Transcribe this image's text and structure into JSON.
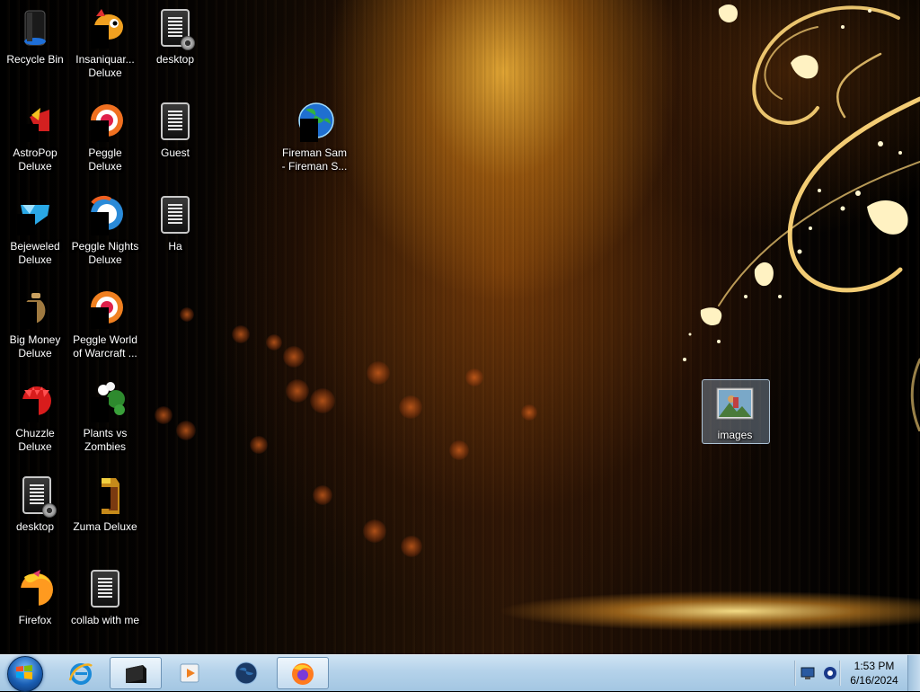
{
  "desktop": {
    "icons": [
      {
        "label": "Recycle Bin",
        "icon": "recycle-bin-icon"
      },
      {
        "label": "AstroPop Deluxe",
        "icon": "astropop-icon"
      },
      {
        "label": "Bejeweled Deluxe",
        "icon": "bejeweled-icon"
      },
      {
        "label": "Big Money Deluxe",
        "icon": "big-money-icon"
      },
      {
        "label": "Chuzzle Deluxe",
        "icon": "chuzzle-icon"
      },
      {
        "label": "desktop",
        "icon": "document-icon"
      },
      {
        "label": "Firefox",
        "icon": "firefox-icon"
      },
      {
        "label": "Insaniquar... Deluxe",
        "icon": "insaniquarium-icon"
      },
      {
        "label": "Peggle Deluxe",
        "icon": "peggle-icon"
      },
      {
        "label": "Peggle Nights Deluxe",
        "icon": "peggle-nights-icon"
      },
      {
        "label": "Peggle World of Warcraft ...",
        "icon": "peggle-wow-icon"
      },
      {
        "label": "Plants vs Zombies",
        "icon": "plants-vs-zombies-icon"
      },
      {
        "label": "Zuma Deluxe",
        "icon": "zuma-icon"
      },
      {
        "label": "collab with me",
        "icon": "document-icon"
      },
      {
        "label": "desktop",
        "icon": "document-icon"
      },
      {
        "label": "Guest",
        "icon": "document-icon"
      },
      {
        "label": "Ha",
        "icon": "document-icon"
      },
      {
        "label": "Fireman Sam - Fireman S...",
        "icon": "globe-icon"
      },
      {
        "label": "images",
        "icon": "image-icon"
      }
    ]
  },
  "taskbar": {
    "start_button": "start-orb-icon",
    "pinned": [
      {
        "name": "internet-explorer-icon"
      },
      {
        "name": "file-explorer-icon",
        "active": true
      },
      {
        "name": "media-player-icon"
      },
      {
        "name": "globe-icon"
      },
      {
        "name": "firefox-icon",
        "active": true
      }
    ],
    "tray": {
      "time": "1:53 PM",
      "date": "6/16/2024"
    }
  },
  "colors": {
    "taskbar_top": "#cfe3f3",
    "taskbar_bottom": "#a3c6e2",
    "label_text": "#ffffff",
    "selection": "#aac8e6"
  }
}
